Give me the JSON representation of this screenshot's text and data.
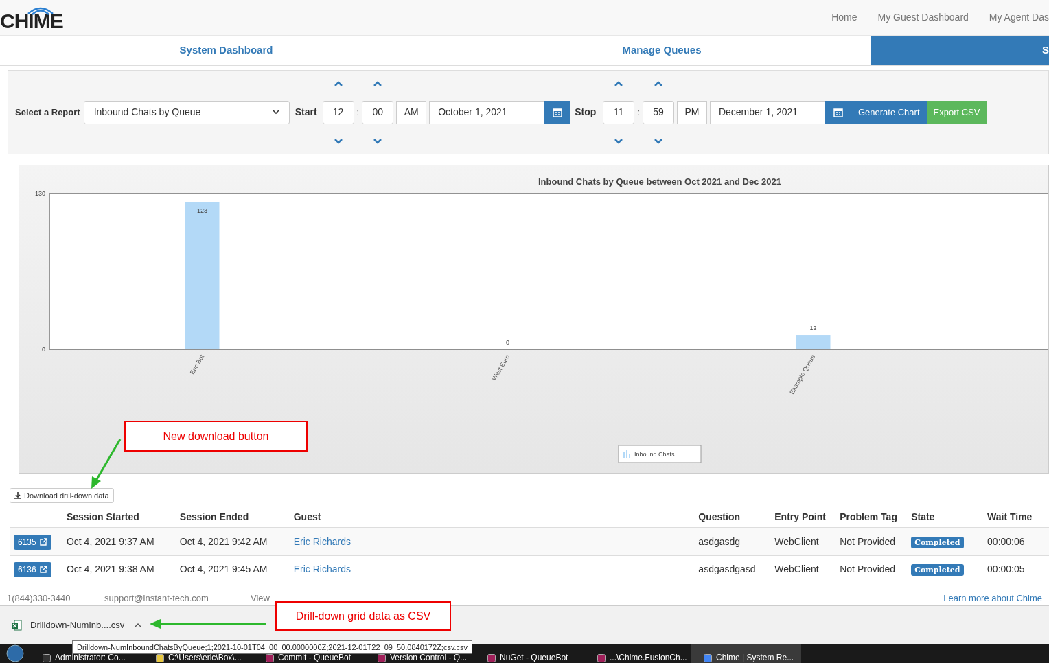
{
  "header": {
    "logo": "CHIME",
    "nav": [
      "Home",
      "My Guest Dashboard",
      "My Agent Das"
    ]
  },
  "tabs": [
    {
      "label": "System Dashboard",
      "selected": false
    },
    {
      "label": "Manage Queues",
      "selected": false
    },
    {
      "label": "S",
      "selected": true
    }
  ],
  "report_form": {
    "report_label": "Select a Report",
    "report_value": "Inbound Chats by Queue",
    "start_label": "Start",
    "start_hour": "12",
    "time_separator": ":",
    "start_minute": "00",
    "start_ampm": "AM",
    "start_date": "October 1, 2021",
    "stop_label": "Stop",
    "stop_hour": "11",
    "stop_minute": "59",
    "stop_ampm": "PM",
    "stop_date": "December 1, 2021",
    "generate_button": "Generate Chart",
    "export_button": "Export CSV"
  },
  "chart": {
    "chart_data": {
      "type": "bar",
      "title": "Inbound Chats by Queue between Oct 2021 and Dec 2021",
      "categories": [
        "Eric Bot",
        "West Euro",
        "Example Queue"
      ],
      "series": [
        {
          "name": "Inbound Chats",
          "color": "#b3d9f7",
          "values": [
            123,
            0,
            12
          ]
        }
      ],
      "ylim": [
        0,
        130
      ],
      "yticks": [
        0,
        130
      ],
      "data_labels": true
    }
  },
  "download_button": "Download drill-down data",
  "table": {
    "columns": [
      "Session Started",
      "Session Ended",
      "Guest",
      "Question",
      "Entry Point",
      "Problem Tag",
      "State",
      "Wait Time"
    ],
    "rows": [
      {
        "id": "6135",
        "cells": [
          "Oct 4, 2021 9:37 AM",
          "Oct 4, 2021 9:42 AM",
          "Eric Richards",
          "asdgasdg",
          "WebClient",
          "Not Provided",
          "Completed",
          "00:00:06"
        ]
      },
      {
        "id": "6136",
        "cells": [
          "Oct 4, 2021 9:38 AM",
          "Oct 4, 2021 9:45 AM",
          "Eric Richards",
          "asdgasdgasd",
          "WebClient",
          "Not Provided",
          "Completed",
          "00:00:05"
        ]
      }
    ]
  },
  "footer": {
    "phone": "1(844)330-3440",
    "email": "support@instant-tech.com",
    "view": "View",
    "learn_more": "Learn more about Chime"
  },
  "download_bar": {
    "file": "Drilldown-NumInb....csv",
    "tooltip": "Drilldown-NumInboundChatsByQueue;1;2021-10-01T04_00_00.0000000Z;2021-12-01T22_09_50.0840172Z;csv.csv"
  },
  "taskbar": [
    "Administrator: Co...",
    "C:\\Users\\eric\\Box\\...",
    "Commit - QueueBot",
    "Version Control - Q...",
    "NuGet - QueueBot",
    "...\\Chime.FusionCh...",
    "Chime | System Re..."
  ],
  "annotations": [
    {
      "text": "New download button"
    },
    {
      "text": "Drill-down grid data as CSV"
    }
  ]
}
